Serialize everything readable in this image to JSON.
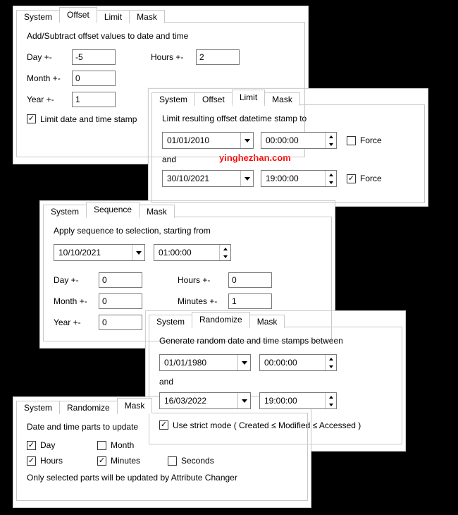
{
  "offset": {
    "tabs": {
      "system": "System",
      "offset": "Offset",
      "limit": "Limit",
      "mask": "Mask"
    },
    "desc": "Add/Subtract offset values to date and time",
    "labels": {
      "day": "Day +-",
      "month": "Month +-",
      "year": "Year +-",
      "hours": "Hours +-"
    },
    "values": {
      "day": "-5",
      "month": "0",
      "year": "1",
      "hours": "2"
    },
    "limit_cb": "Limit date and time stamp"
  },
  "limit": {
    "tabs": {
      "system": "System",
      "offset": "Offset",
      "limit": "Limit",
      "mask": "Mask"
    },
    "desc": "Limit resulting offset datetime stamp to",
    "from": {
      "date": "01/01/2010",
      "time": "00:00:00",
      "force": "Force"
    },
    "and": "and",
    "to": {
      "date": "30/10/2021",
      "time": "19:00:00",
      "force": "Force"
    }
  },
  "sequence": {
    "tabs": {
      "system": "System",
      "sequence": "Sequence",
      "mask": "Mask"
    },
    "desc": "Apply sequence to selection, starting from",
    "start": {
      "date": "10/10/2021",
      "time": "01:00:00"
    },
    "labels": {
      "day": "Day +-",
      "month": "Month +-",
      "year": "Year +-",
      "hours": "Hours +-",
      "minutes": "Minutes +-"
    },
    "values": {
      "day": "0",
      "month": "0",
      "year": "0",
      "hours": "0",
      "minutes": "1"
    }
  },
  "randomize": {
    "tabs": {
      "system": "System",
      "randomize": "Randomize",
      "mask": "Mask"
    },
    "desc": "Generate random date and time stamps between",
    "from": {
      "date": "01/01/1980",
      "time": "00:00:00"
    },
    "and": "and",
    "to": {
      "date": "16/03/2022",
      "time": "19:00:00"
    },
    "strict_cb": "Use strict mode ( Created ≤ Modified ≤ Accessed )"
  },
  "mask": {
    "tabs": {
      "system": "System",
      "randomize": "Randomize",
      "mask": "Mask"
    },
    "desc": "Date and time parts to update",
    "parts": {
      "day": "Day",
      "month": "Month",
      "hours": "Hours",
      "minutes": "Minutes",
      "seconds": "Seconds"
    },
    "note": "Only selected parts will be updated by Attribute Changer"
  },
  "watermark": "yinghezhan.com"
}
